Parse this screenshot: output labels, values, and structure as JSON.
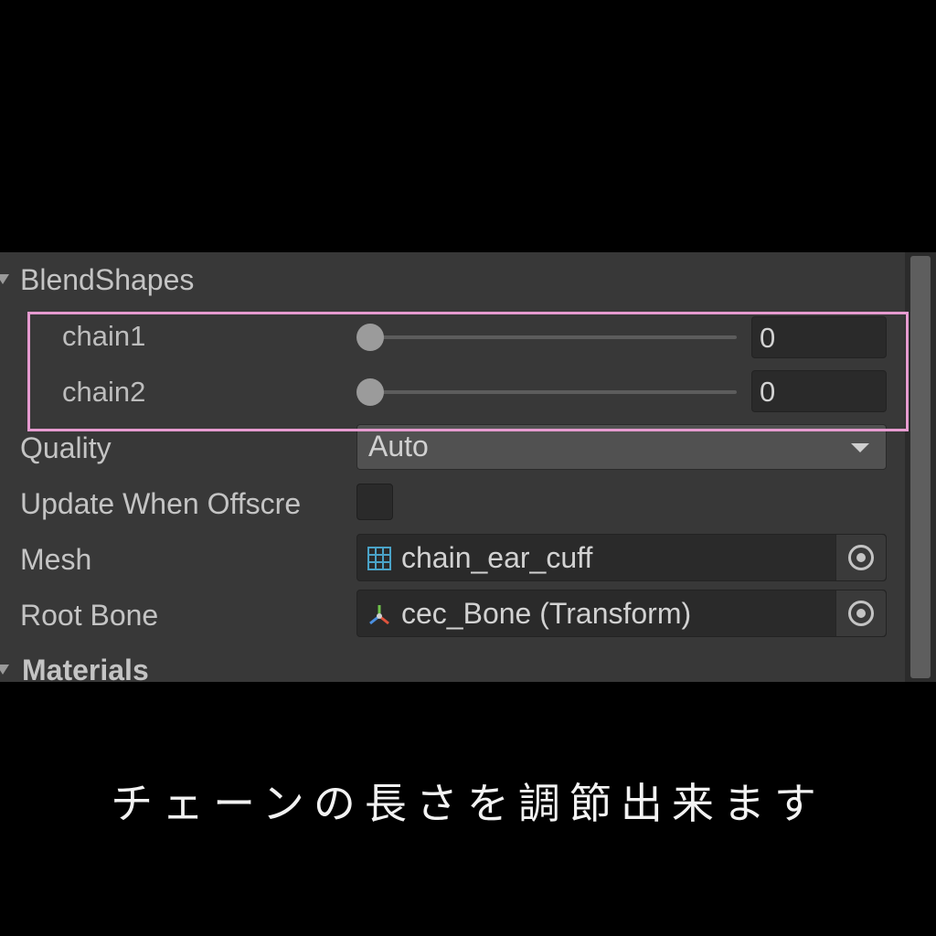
{
  "inspector": {
    "blendshapes": {
      "header": "BlendShapes",
      "items": [
        {
          "label": "chain1",
          "value": "0"
        },
        {
          "label": "chain2",
          "value": "0"
        }
      ]
    },
    "quality": {
      "label": "Quality",
      "value": "Auto"
    },
    "update_offscreen": {
      "label": "Update When Offscre",
      "checked": false
    },
    "mesh": {
      "label": "Mesh",
      "value": "chain_ear_cuff",
      "icon": "mesh-icon"
    },
    "root_bone": {
      "label": "Root Bone",
      "value": "cec_Bone (Transform)",
      "icon": "transform-icon"
    },
    "materials": {
      "header": "Materials"
    }
  },
  "caption": "チェーンの長さを調節出来ます",
  "colors": {
    "background": "#000000",
    "panel": "#383838",
    "highlight": "#e69bd0",
    "text": "#c4c4c4"
  }
}
